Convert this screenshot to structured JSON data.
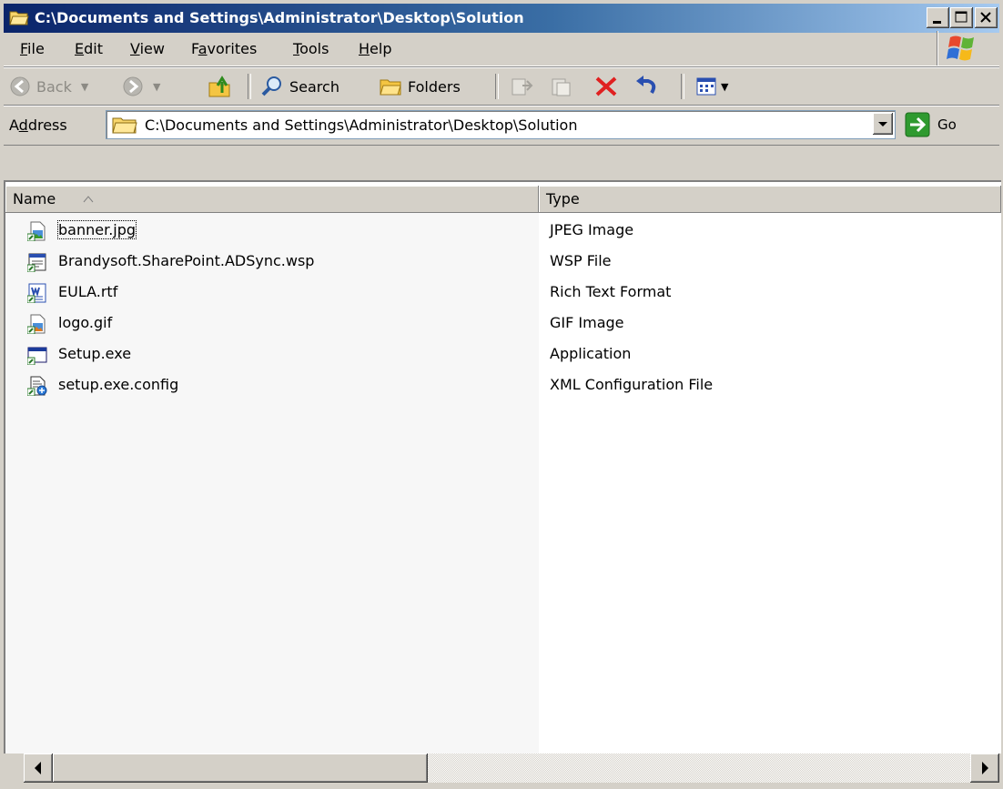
{
  "window": {
    "title": "C:\\Documents and Settings\\Administrator\\Desktop\\Solution",
    "title_color": "#0a246a"
  },
  "menu": {
    "items": [
      {
        "label": "File",
        "accel": "F",
        "rest": "ile"
      },
      {
        "label": "Edit",
        "accel": "E",
        "rest": "dit"
      },
      {
        "label": "View",
        "accel": "V",
        "rest": "iew"
      },
      {
        "label": "Favorites",
        "pre": "F",
        "accel": "a",
        "rest": "vorites"
      },
      {
        "label": "Tools",
        "accel": "T",
        "rest": "ools"
      },
      {
        "label": "Help",
        "accel": "H",
        "rest": "elp"
      }
    ]
  },
  "toolbar": {
    "back_label": "Back",
    "search_label": "Search",
    "folders_label": "Folders"
  },
  "address": {
    "label_pre": "A",
    "label_accel": "d",
    "label_rest": "dress",
    "value": "C:\\Documents and Settings\\Administrator\\Desktop\\Solution",
    "go_label": "Go"
  },
  "columns": {
    "name": "Name",
    "type": "Type"
  },
  "files": [
    {
      "name": "banner.jpg",
      "type": "JPEG Image",
      "icon": "image-file-icon"
    },
    {
      "name": "Brandysoft.SharePoint.ADSync.wsp",
      "type": "WSP File",
      "icon": "generic-file-icon"
    },
    {
      "name": "EULA.rtf",
      "type": "Rich Text Format",
      "icon": "wordpad-document-icon"
    },
    {
      "name": "logo.gif",
      "type": "GIF Image",
      "icon": "image-file-icon"
    },
    {
      "name": "Setup.exe",
      "type": "Application",
      "icon": "application-icon"
    },
    {
      "name": "setup.exe.config",
      "type": "XML Configuration File",
      "icon": "config-file-icon"
    }
  ]
}
